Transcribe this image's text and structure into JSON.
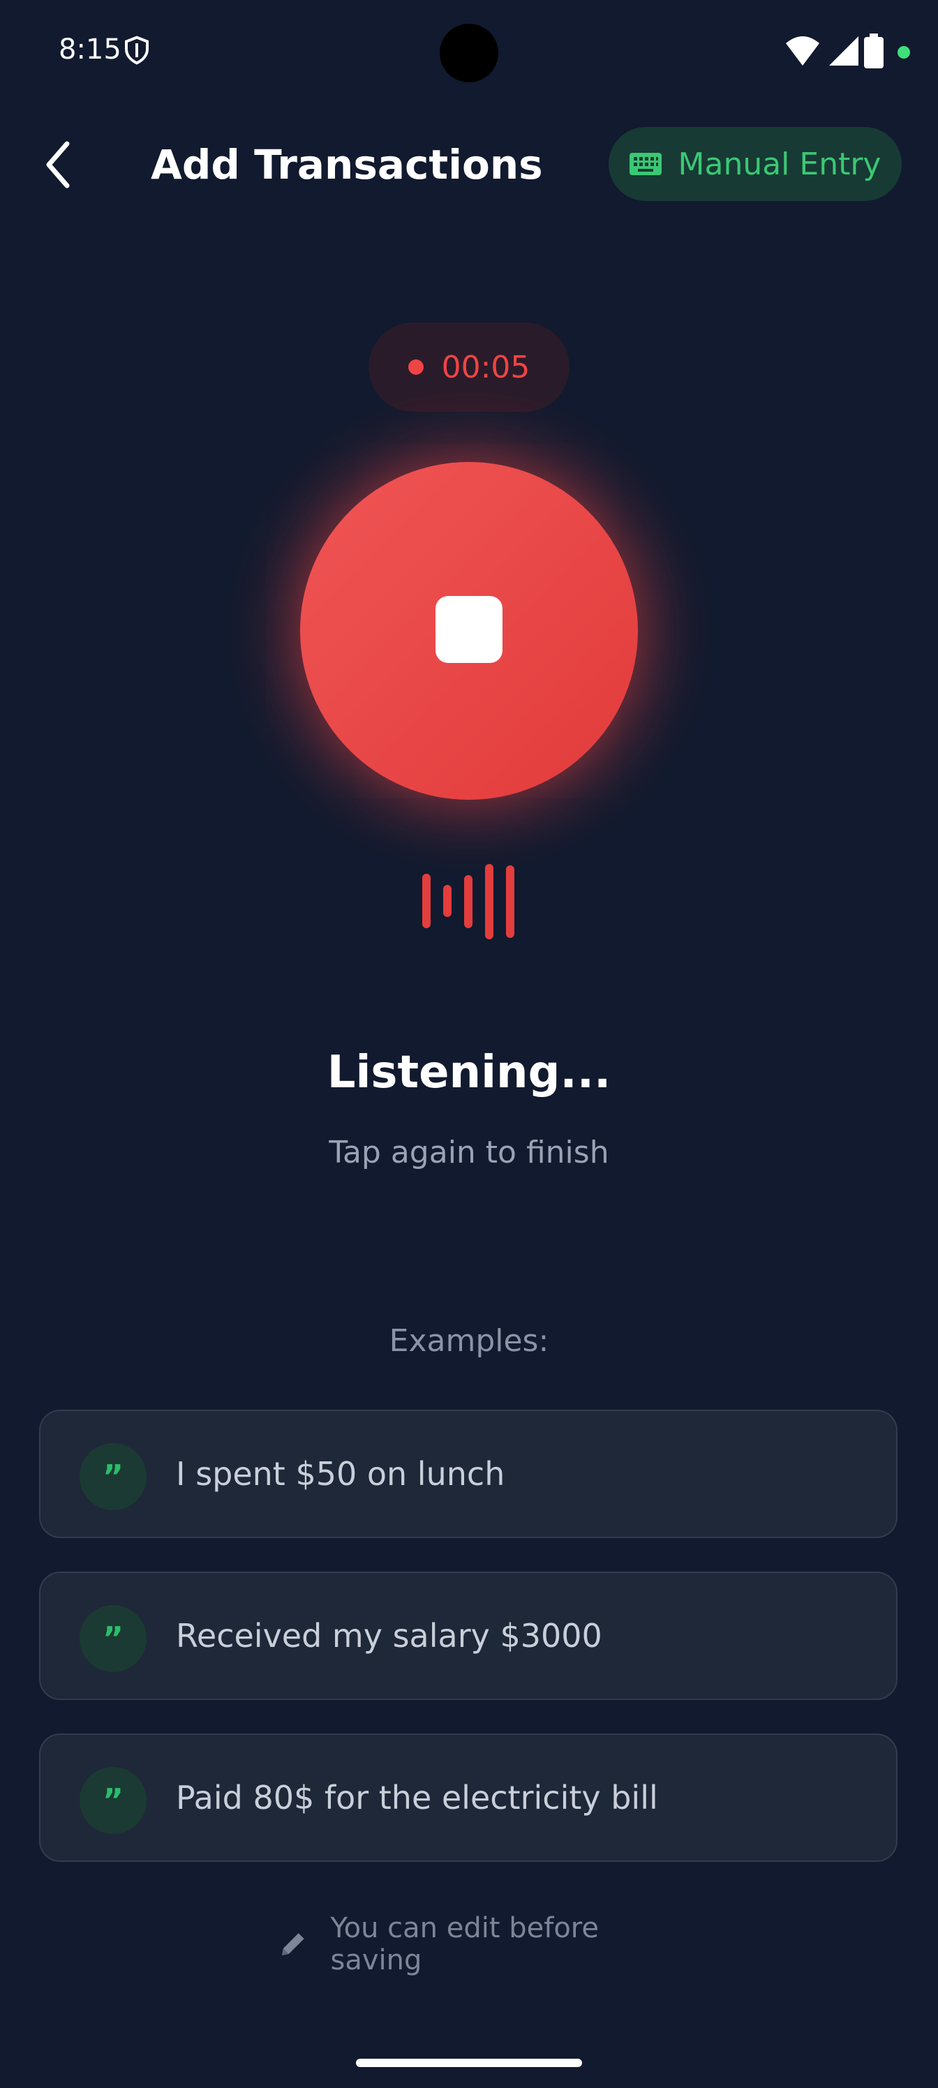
{
  "status_bar": {
    "time": "8:15"
  },
  "header": {
    "title": "Add Transactions",
    "manual_entry_label": "Manual Entry"
  },
  "recording": {
    "timer": "00:05",
    "status_title": "Listening...",
    "status_subtitle": "Tap again to finish"
  },
  "examples": {
    "label": "Examples:",
    "items": [
      {
        "text": "I spent $50 on lunch"
      },
      {
        "text": "Received my salary $3000"
      },
      {
        "text": "Paid 80$ for the electricity bill"
      }
    ]
  },
  "footer": {
    "edit_hint": "You can edit before saving"
  },
  "colors": {
    "background": "#111a2e",
    "record_red": "#ef4444",
    "accent_green": "#3ac874",
    "card_background": "#1f2838"
  },
  "icons": {
    "back": "arrow-left-icon",
    "manual": "keyboard-icon",
    "stop": "stop-icon",
    "quote": "quote-icon",
    "edit": "pencil-icon"
  }
}
